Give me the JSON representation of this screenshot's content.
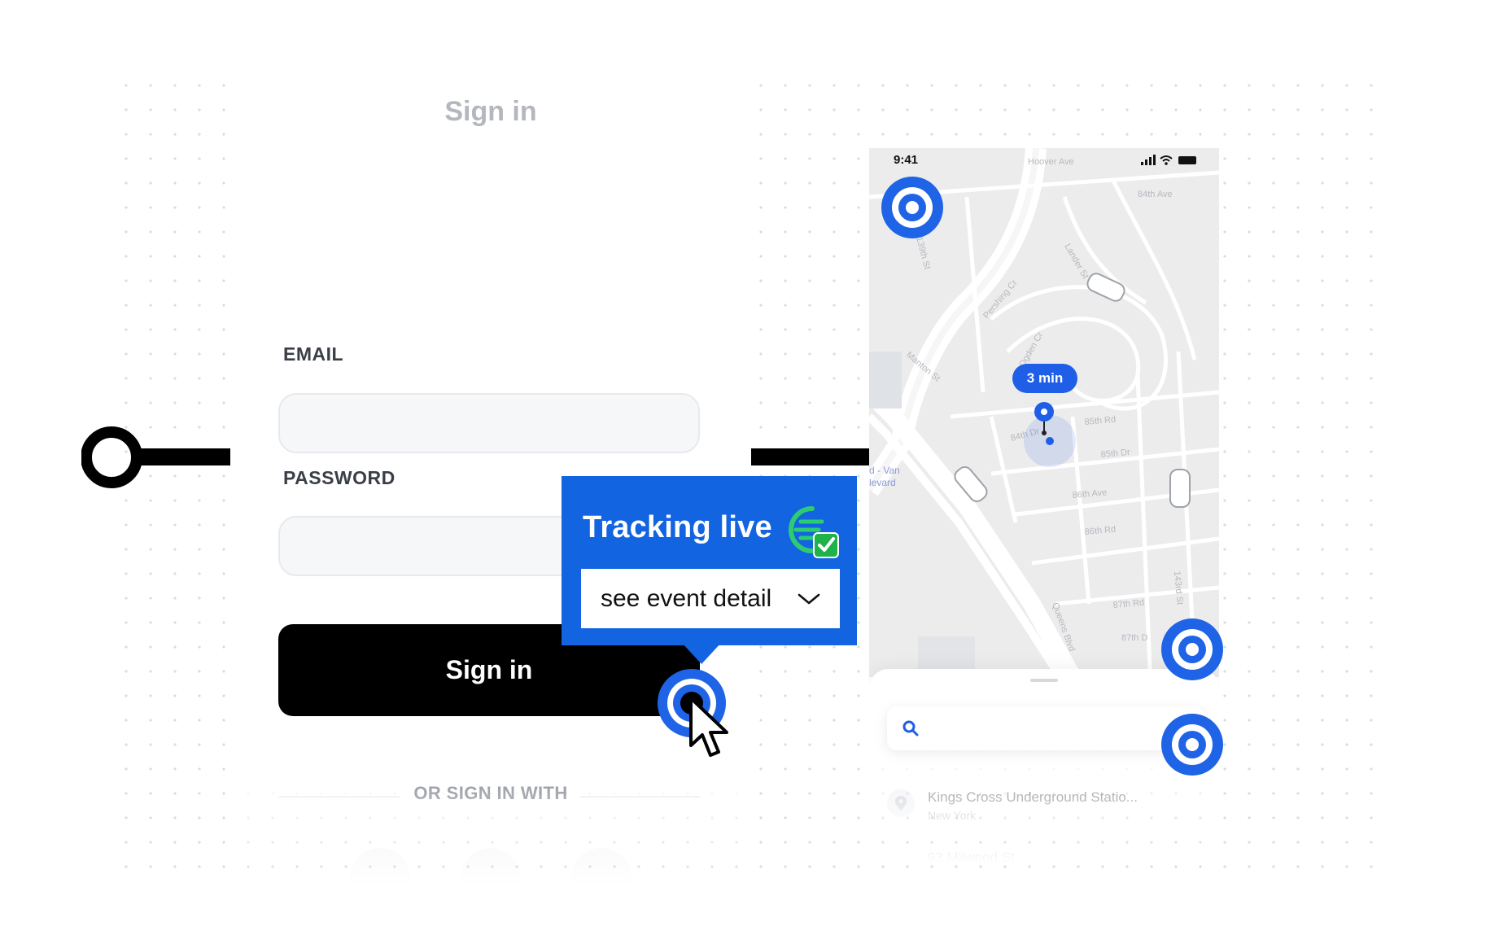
{
  "login": {
    "title": "Sign in",
    "email_label": "EMAIL",
    "email_value": "",
    "password_label": "PASSWORD",
    "password_value": "",
    "submit_label": "Sign in",
    "divider_text": "OR  SIGN IN WITH",
    "social_buttons": 3
  },
  "tracking_callout": {
    "title": "Tracking live",
    "status_icon": "check-icon",
    "dropdown_value": "see event detail",
    "dropdown_icon": "chevron-down-icon"
  },
  "phone": {
    "status_time": "9:41",
    "eta_label": "3 min",
    "streets": [
      "Hoover Ave",
      "84th Ave",
      "Lander St",
      "Pershing Cr",
      "Ogden Cr",
      "Manton St",
      "84th Dr",
      "85th Rd",
      "85th Dr",
      "86th Ave",
      "86th Rd",
      "87th Rd",
      "87th D",
      "Queens Blvd",
      "143rd St",
      "139th St",
      "Ave",
      "d - Van",
      "levard"
    ],
    "search_placeholder": "",
    "places": [
      {
        "name": "Kings Cross Underground Statio...",
        "sub": "New York"
      },
      {
        "name": "93 Milwood St",
        "sub": ""
      }
    ]
  },
  "colors": {
    "accent": "#1264e0",
    "target_ring": "#1f63e6",
    "button": "#000000",
    "check_green": "#1fb24a",
    "map_bg": "#ececec"
  }
}
